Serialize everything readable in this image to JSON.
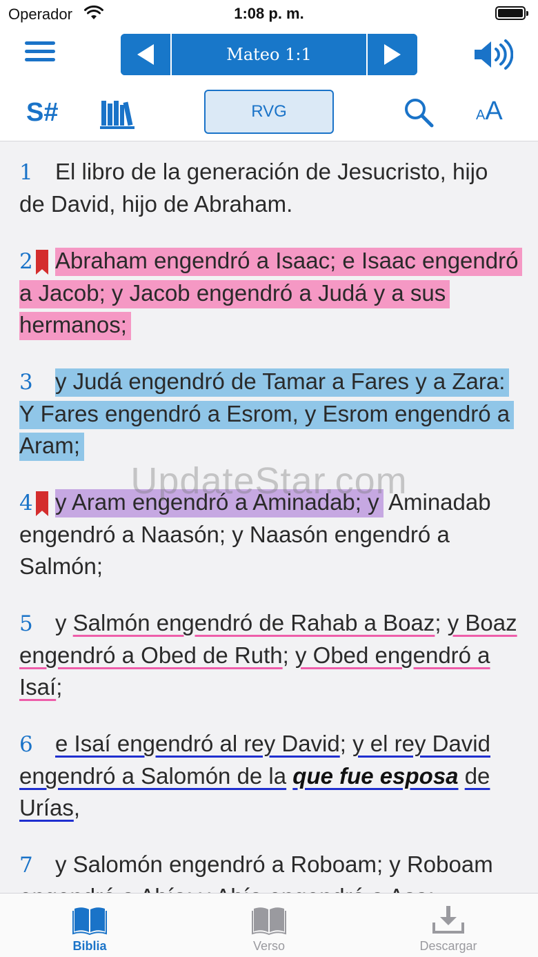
{
  "status_bar": {
    "carrier": "Operador",
    "time": "1:08 p. m."
  },
  "nav": {
    "reference": "Mateo 1:1",
    "strongs_label": "S#",
    "version": "RVG",
    "font_small": "A",
    "font_large": "A"
  },
  "verses": [
    {
      "num": "1",
      "text": "El libro de la generación de Jesucristo, hijo de David, hijo de Abraham."
    },
    {
      "num": "2",
      "text": "Abraham engendró a Isaac; e Isaac engendró a Jacob; y Jacob engendró a Judá y a sus hermanos;",
      "highlight": "pink",
      "bookmarked": true
    },
    {
      "num": "3",
      "text": "y Judá engendró de Tamar a Fares y a Zara: Y Fares engendró a Esrom, y Esrom engendró a Aram;",
      "highlight": "blue"
    },
    {
      "num": "4",
      "text_highlighted": "y Aram engendró a Aminadab; y",
      "text_rest": "Aminadab engendró a Naasón; y Naasón engendró a Salmón;",
      "highlight": "purple",
      "bookmarked": true
    },
    {
      "num": "5",
      "lead": "y",
      "underlined_1": "Salmón engendró de Rahab a Boaz",
      "sep_1": ";",
      "underlined_2": "y Boaz engendró a Obed de Ruth",
      "sep_2": ";",
      "underlined_3": "y Obed engendró a Isaí",
      "end": ";",
      "underline": "pink"
    },
    {
      "num": "6",
      "underlined_1": "e Isaí engendró al rey David",
      "sep_1": ";",
      "underlined_2": "y el rey David engendró a Salomón de la",
      "italic": "que fue esposa",
      "underlined_3": "de Urías",
      "end": ",",
      "underline": "blue"
    },
    {
      "num": "7",
      "text": "y Salomón engendró a Roboam; y Roboam engendró a Abía; y Abía engendró a Asa;"
    }
  ],
  "watermark": "UpdateStar.com",
  "tabs": [
    {
      "label": "Biblia",
      "active": true
    },
    {
      "label": "Verso",
      "active": false
    },
    {
      "label": "Descargar",
      "active": false
    }
  ],
  "colors": {
    "accent": "#1a73c8",
    "highlight_pink": "#f598c4",
    "highlight_blue": "#90c6e8",
    "highlight_purple": "#c6a8e2",
    "bookmark": "#d42d2d"
  }
}
